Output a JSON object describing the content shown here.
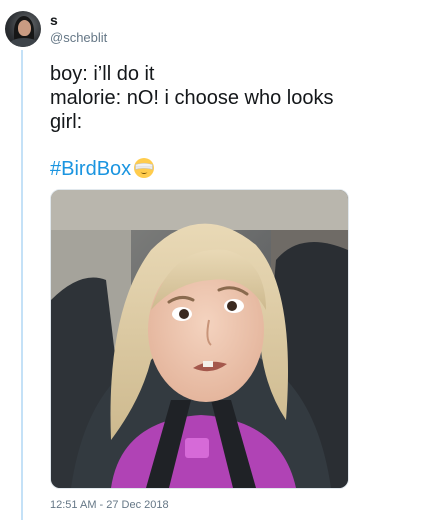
{
  "user": {
    "display_name": "s",
    "handle": "@scheblit",
    "avatar_icon": "profile-photo"
  },
  "tweet": {
    "lines": [
      "boy: i’ll do it",
      "malorie: nO! i choose who looks",
      "girl:"
    ],
    "hashtag": "#BirdBox",
    "emoji": "blindfolded-face-emoji",
    "timestamp": "12:51 AM - 27 Dec 2018"
  },
  "media": {
    "kind": "photo",
    "subject": "girl in car seat meme"
  },
  "colors": {
    "link": "#1b95e0",
    "text": "#14171a",
    "muted": "#657786",
    "thread_line": "#c4e1f7"
  }
}
